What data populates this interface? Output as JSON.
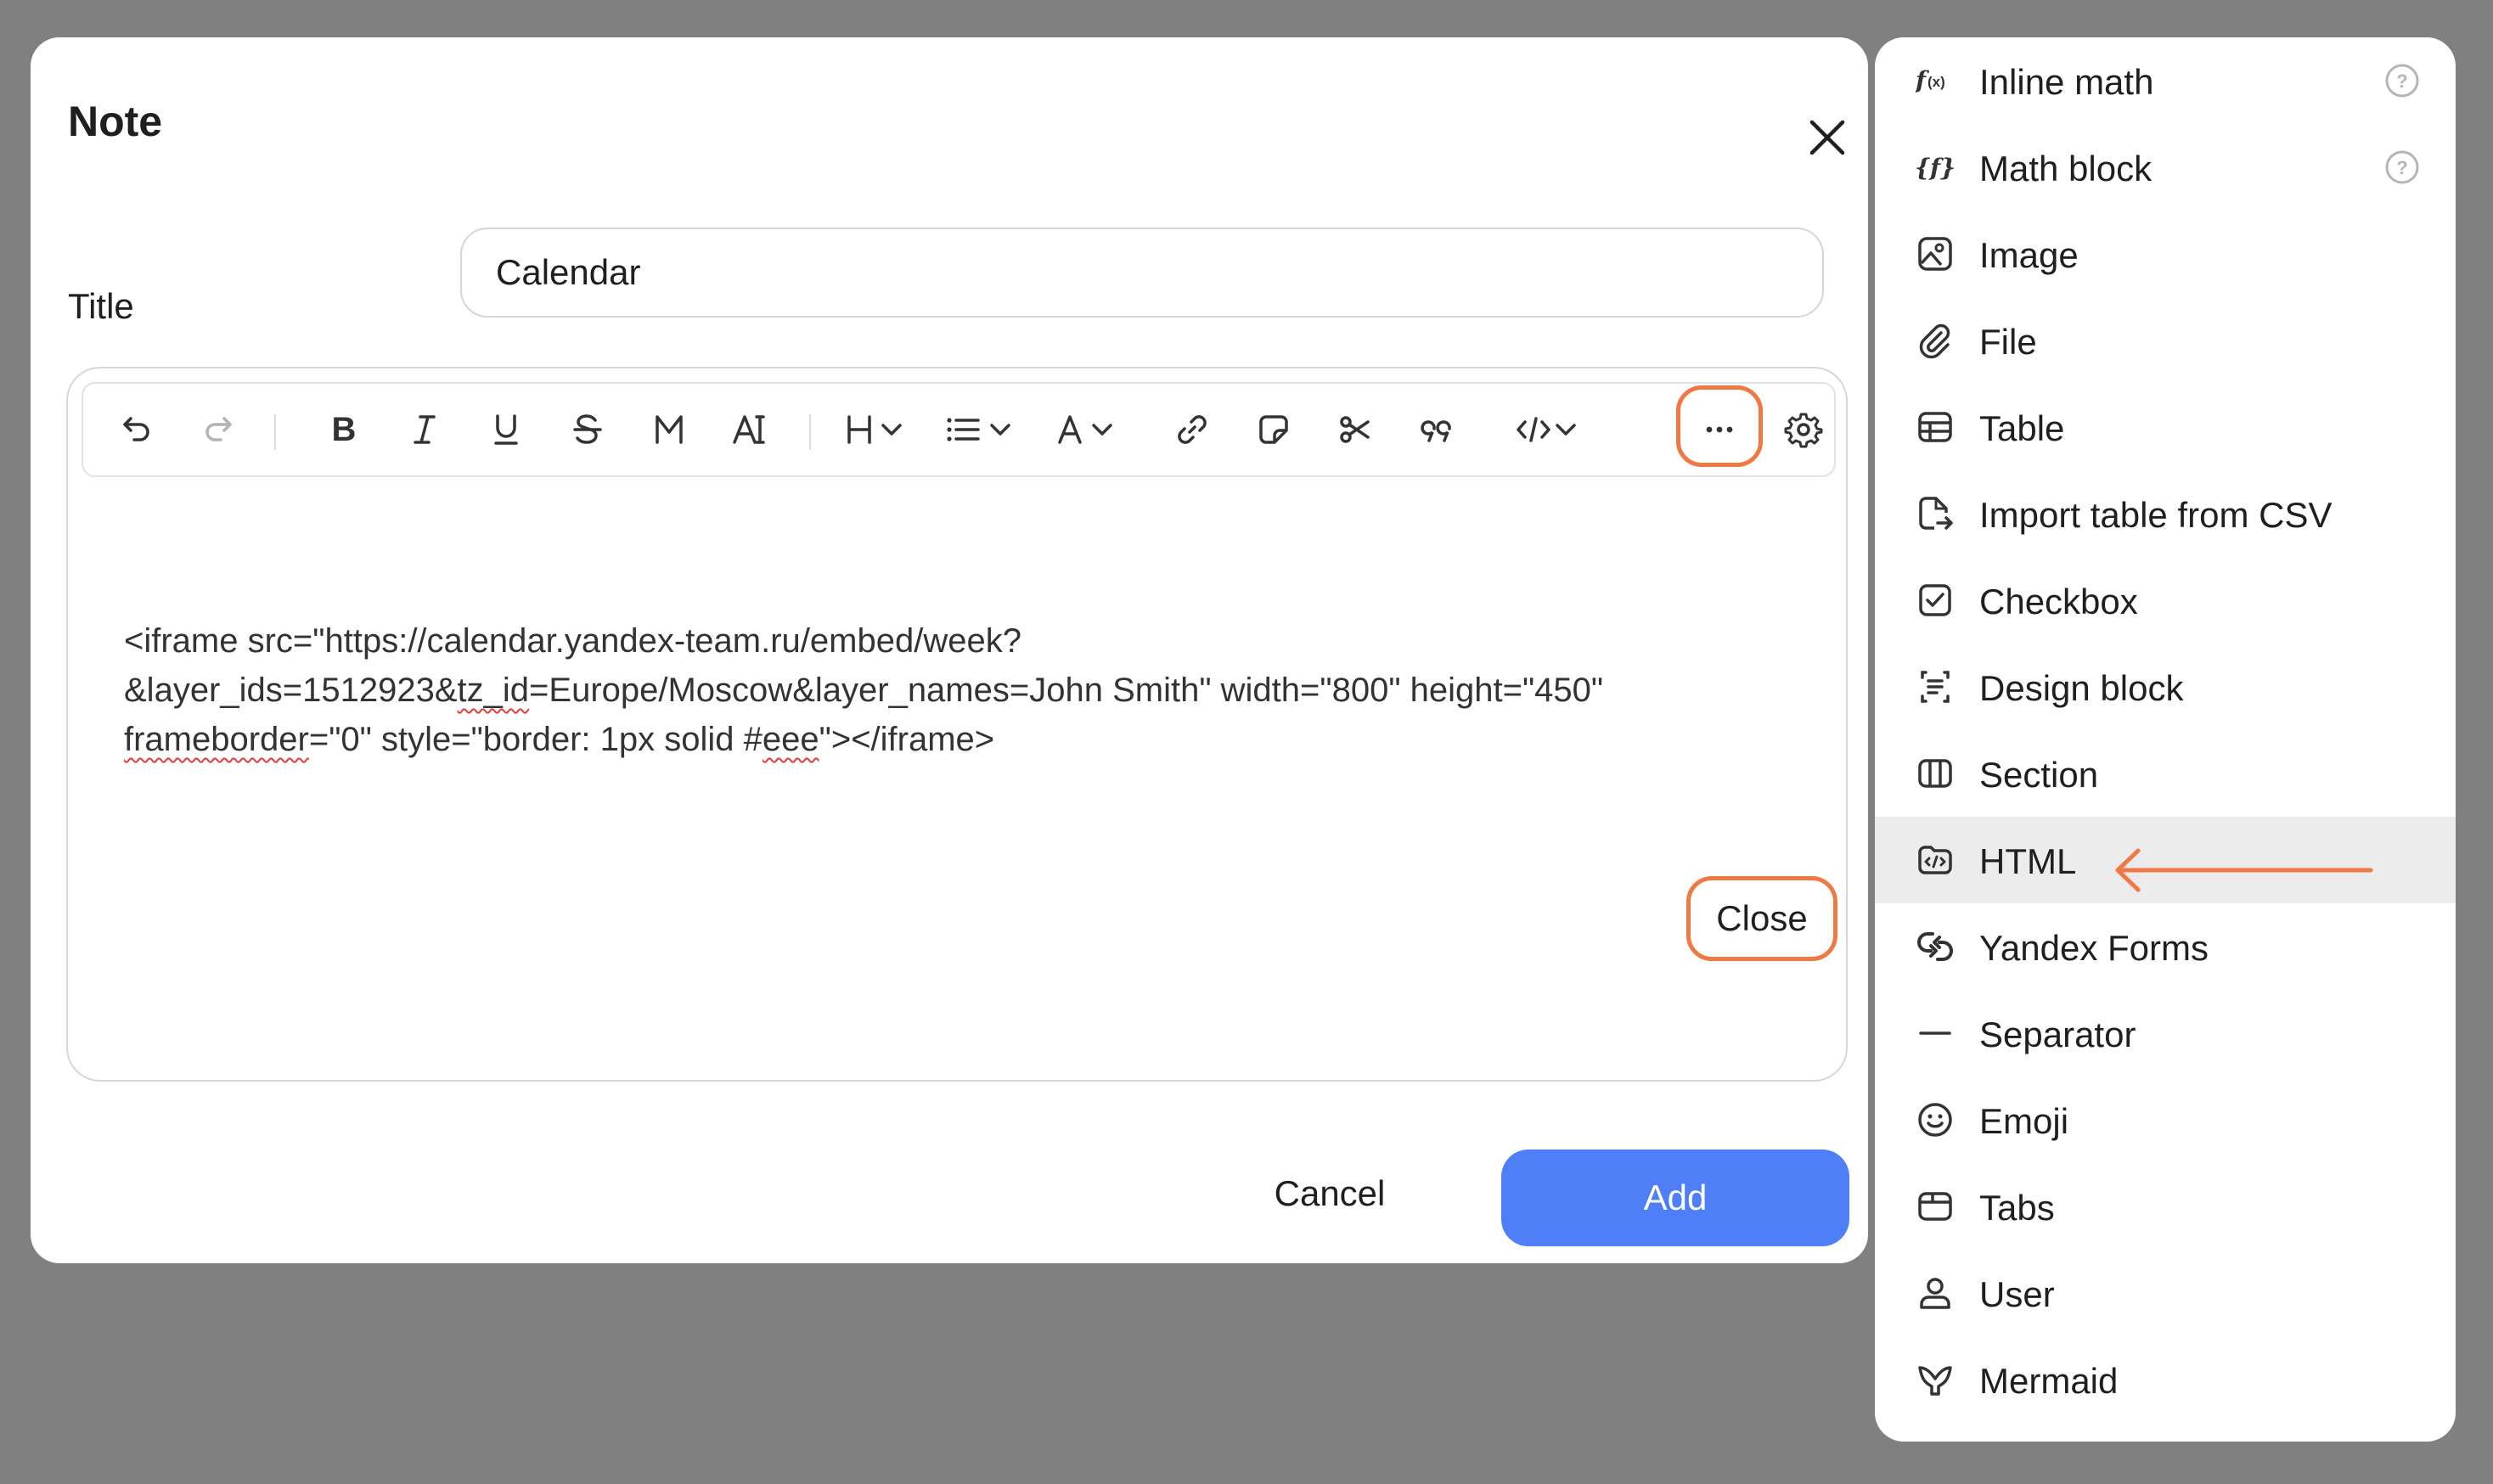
{
  "dialog": {
    "title": "Note",
    "title_field_label": "Title",
    "title_field_value": "Calendar",
    "editor_code": {
      "line1": "<iframe src=\"https://calendar.yandex-team.ru/embed/week?",
      "line2_a": "&layer_ids=1512923&",
      "line2_b": "tz_id",
      "line2_c": "=Europe/Moscow&layer_names=John Smith\" width=\"800\" height=\"450\"",
      "line3_a": "frameborder",
      "line3_b": "=\"0\" style=\"border: 1px solid #",
      "line3_c": "eee",
      "line3_d": "\"></iframe>"
    },
    "close_label": "Close",
    "cancel_label": "Cancel",
    "add_label": "Add"
  },
  "toolbar": {
    "items": [
      {
        "name": "undo-icon"
      },
      {
        "name": "redo-icon"
      },
      {
        "name": "bold-icon",
        "glyph": "B"
      },
      {
        "name": "italic-icon",
        "glyph": "I"
      },
      {
        "name": "underline-icon",
        "glyph": "U"
      },
      {
        "name": "strikethrough-icon",
        "glyph": "S"
      },
      {
        "name": "monospace-icon",
        "glyph": "M"
      },
      {
        "name": "marked-text-icon",
        "glyph": "A"
      },
      {
        "name": "heading-icon",
        "glyph": "H"
      },
      {
        "name": "list-icon"
      },
      {
        "name": "text-color-icon",
        "glyph": "A"
      },
      {
        "name": "link-icon"
      },
      {
        "name": "note-icon"
      },
      {
        "name": "cut-icon"
      },
      {
        "name": "quote-icon"
      },
      {
        "name": "code-icon"
      },
      {
        "name": "more-icon"
      },
      {
        "name": "settings-icon"
      }
    ],
    "highlighted": "more-icon"
  },
  "menu": {
    "items": [
      {
        "label": "Inline math",
        "icon": "inline-math-icon",
        "help": true
      },
      {
        "label": "Math block",
        "icon": "math-block-icon",
        "help": true
      },
      {
        "label": "Image",
        "icon": "image-icon"
      },
      {
        "label": "File",
        "icon": "paperclip-icon"
      },
      {
        "label": "Table",
        "icon": "table-icon"
      },
      {
        "label": "Import table from CSV",
        "icon": "csv-import-icon"
      },
      {
        "label": "Checkbox",
        "icon": "checkbox-icon"
      },
      {
        "label": "Design block",
        "icon": "design-block-icon"
      },
      {
        "label": "Section",
        "icon": "section-icon"
      },
      {
        "label": "HTML",
        "icon": "html-icon",
        "active": true
      },
      {
        "label": "Yandex Forms",
        "icon": "yandex-forms-icon"
      },
      {
        "label": "Separator",
        "icon": "separator-icon"
      },
      {
        "label": "Emoji",
        "icon": "emoji-icon"
      },
      {
        "label": "Tabs",
        "icon": "tabs-icon"
      },
      {
        "label": "User",
        "icon": "user-icon"
      },
      {
        "label": "Mermaid",
        "icon": "mermaid-icon"
      }
    ]
  },
  "colors": {
    "accent_highlight": "#f07843",
    "primary_button": "#4f7ff8",
    "backdrop": "#808080"
  }
}
